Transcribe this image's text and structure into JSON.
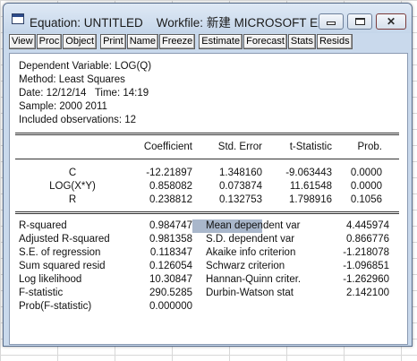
{
  "window": {
    "title": "Equation: UNTITLED    Workfile: 新建 MICROSOFT EX...",
    "buttons": {
      "minimize": "minimize",
      "maximize": "maximize",
      "close": "close"
    }
  },
  "toolbar": {
    "items": [
      "View",
      "Proc",
      "Object",
      "Print",
      "Name",
      "Freeze",
      "Estimate",
      "Forecast",
      "Stats",
      "Resids"
    ]
  },
  "header": {
    "dependent": "Dependent Variable: LOG(Q)",
    "method": "Method: Least Squares",
    "date": "Date: 12/12/14   Time: 14:19",
    "sample": "Sample: 2000 2011",
    "observations": "Included observations: 12"
  },
  "coef_table": {
    "columns": [
      "Coefficient",
      "Std. Error",
      "t-Statistic",
      "Prob."
    ],
    "rows": [
      {
        "variable": "C",
        "coefficient": "-12.21897",
        "std_error": "1.348160",
        "t_stat": "-9.063443",
        "prob": "0.0000"
      },
      {
        "variable": "LOG(X*Y)",
        "coefficient": "0.858082",
        "std_error": "0.073874",
        "t_stat": "11.61548",
        "prob": "0.0000"
      },
      {
        "variable": "R",
        "coefficient": "0.238812",
        "std_error": "0.132753",
        "t_stat": "1.798916",
        "prob": "0.1056"
      }
    ]
  },
  "summary_stats": {
    "left": [
      {
        "label": "R-squared",
        "value": "0.984747"
      },
      {
        "label": "Adjusted R-squared",
        "value": "0.981358"
      },
      {
        "label": "S.E. of regression",
        "value": "0.118347"
      },
      {
        "label": "Sum squared resid",
        "value": "0.126054"
      },
      {
        "label": "Log likelihood",
        "value": "10.30847"
      },
      {
        "label": "F-statistic",
        "value": "290.5285"
      },
      {
        "label": "Prob(F-statistic)",
        "value": "0.000000"
      }
    ],
    "right": [
      {
        "label": "Mean dependent var",
        "value": "4.445974"
      },
      {
        "label": "S.D. dependent var",
        "value": "0.866776"
      },
      {
        "label": "Akaike info criterion",
        "value": "-1.218078"
      },
      {
        "label": "Schwarz criterion",
        "value": "-1.096851"
      },
      {
        "label": "Hannan-Quinn criter.",
        "value": "-1.262960"
      },
      {
        "label": "Durbin-Watson stat",
        "value": "2.142100"
      }
    ]
  },
  "colors": {
    "titlebar": "#c9d9ec",
    "selection": "#a9b7cb",
    "window_border": "#5a6f8e"
  },
  "icons": {
    "app": "eviews-window-icon",
    "minimize": "minimize-icon",
    "maximize": "maximize-icon",
    "close": "close-icon"
  }
}
